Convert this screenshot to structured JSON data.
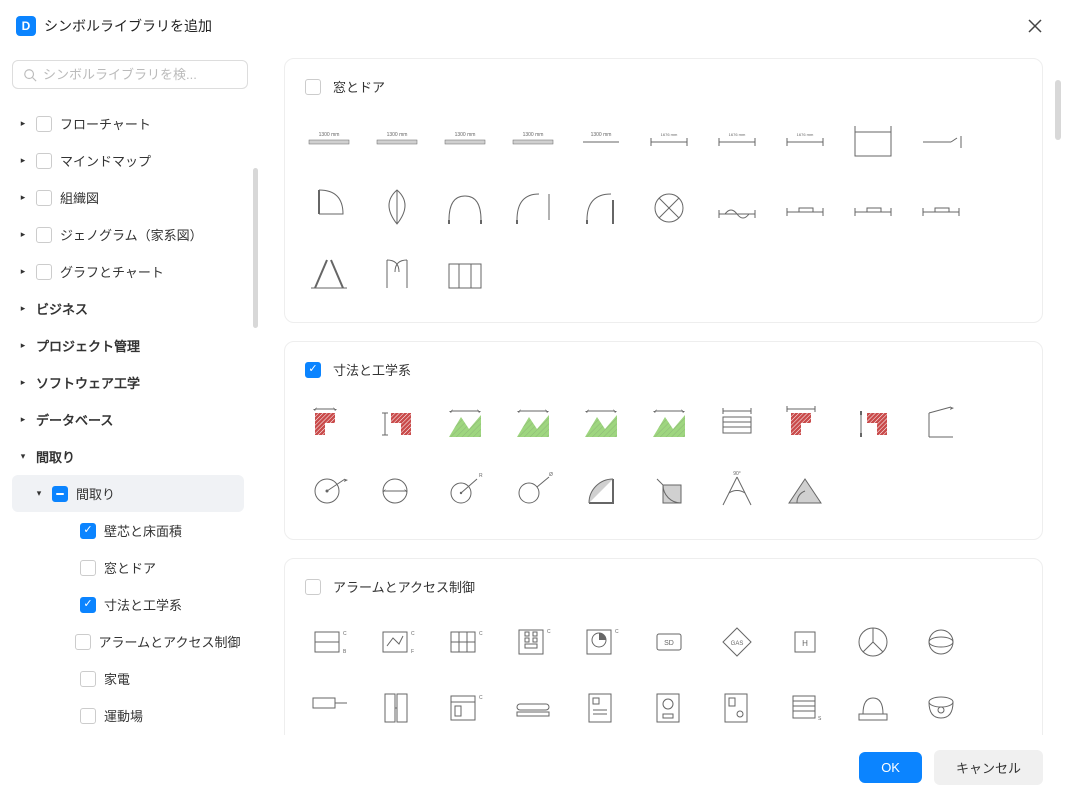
{
  "header": {
    "title": "シンボルライブラリを追加",
    "app_icon_label": "D"
  },
  "search": {
    "placeholder": "シンボルライブラリを検..."
  },
  "sidebar": {
    "items": [
      {
        "label": "フローチャート",
        "caret": "right",
        "checkbox": "unchecked",
        "bold": false,
        "indent": 0
      },
      {
        "label": "マインドマップ",
        "caret": "right",
        "checkbox": "unchecked",
        "bold": false,
        "indent": 0
      },
      {
        "label": "組織図",
        "caret": "right",
        "checkbox": "unchecked",
        "bold": false,
        "indent": 0
      },
      {
        "label": "ジェノグラム（家系図）",
        "caret": "right",
        "checkbox": "unchecked",
        "bold": false,
        "indent": 0
      },
      {
        "label": "グラフとチャート",
        "caret": "right",
        "checkbox": "unchecked",
        "bold": false,
        "indent": 0
      },
      {
        "label": "ビジネス",
        "caret": "right",
        "checkbox": "none",
        "bold": true,
        "indent": 0
      },
      {
        "label": "プロジェクト管理",
        "caret": "right",
        "checkbox": "none",
        "bold": true,
        "indent": 0
      },
      {
        "label": "ソフトウェア工学",
        "caret": "right",
        "checkbox": "none",
        "bold": true,
        "indent": 0
      },
      {
        "label": "データベース",
        "caret": "right",
        "checkbox": "none",
        "bold": true,
        "indent": 0
      },
      {
        "label": "間取り",
        "caret": "down",
        "checkbox": "none",
        "bold": true,
        "indent": 0
      },
      {
        "label": "間取り",
        "caret": "down",
        "checkbox": "indet",
        "bold": false,
        "indent": 1,
        "selected": true
      },
      {
        "label": "壁芯と床面積",
        "caret": "none",
        "checkbox": "checked",
        "bold": false,
        "indent": 2
      },
      {
        "label": "窓とドア",
        "caret": "none",
        "checkbox": "unchecked",
        "bold": false,
        "indent": 2
      },
      {
        "label": "寸法と工学系",
        "caret": "none",
        "checkbox": "checked",
        "bold": false,
        "indent": 2
      },
      {
        "label": "アラームとアクセス制御",
        "caret": "none",
        "checkbox": "unchecked",
        "bold": false,
        "indent": 2
      },
      {
        "label": "家電",
        "caret": "none",
        "checkbox": "unchecked",
        "bold": false,
        "indent": 2
      },
      {
        "label": "運動場",
        "caret": "none",
        "checkbox": "unchecked",
        "bold": false,
        "indent": 2
      }
    ]
  },
  "main": {
    "cards": [
      {
        "title": "窓とドア",
        "checkbox": "unchecked",
        "thumb_group": "windows",
        "thumb_count": 23
      },
      {
        "title": "寸法と工学系",
        "checkbox": "checked",
        "thumb_group": "dimension",
        "thumb_count": 18
      },
      {
        "title": "アラームとアクセス制御",
        "checkbox": "unchecked",
        "thumb_group": "alarm",
        "thumb_count": 20
      }
    ]
  },
  "footer": {
    "ok_label": "OK",
    "cancel_label": "キャンセル"
  },
  "colors": {
    "accent": "#0b84ff",
    "green": "#9ed67f",
    "red": "#c94a4a",
    "line": "#666666",
    "soft": "#d0d0d0"
  }
}
